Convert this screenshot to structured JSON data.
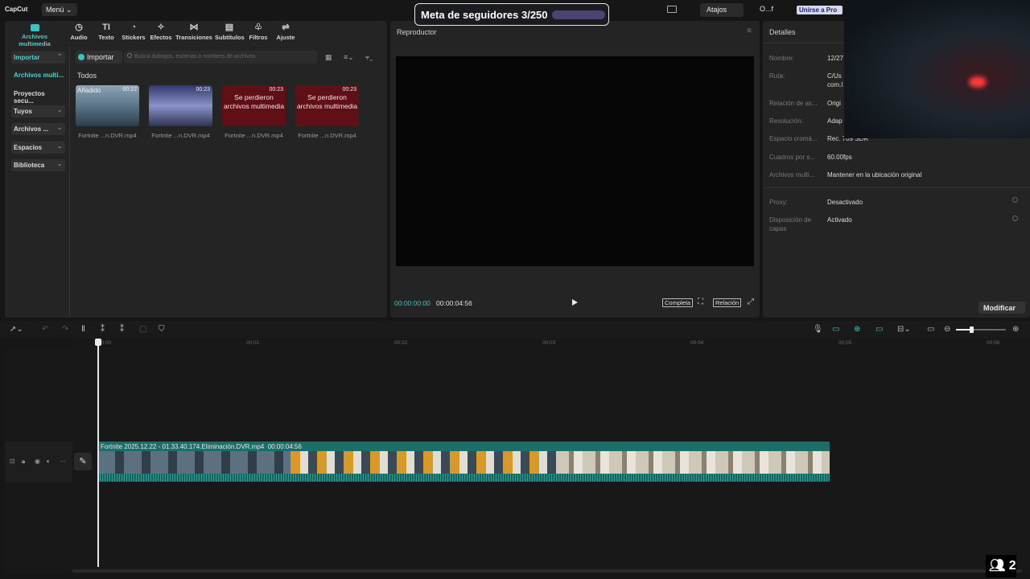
{
  "app": {
    "logo": "CapCut",
    "menu_label": "Menú ⌄"
  },
  "overlay": {
    "goal_text": "Meta de seguidores 3/250",
    "viewers": "2"
  },
  "header": {
    "shortcuts_label": "Atajos",
    "user_label": "O...f",
    "pro_label": "Unirse a Pro"
  },
  "toolbar": {
    "items": [
      {
        "label": "Archivos multimedia",
        "icon": "media-icon"
      },
      {
        "label": "Audio",
        "icon": "audio-icon"
      },
      {
        "label": "Texto",
        "icon": "text-icon"
      },
      {
        "label": "Stickers",
        "icon": "sticker-icon"
      },
      {
        "label": "Efectos",
        "icon": "effects-icon"
      },
      {
        "label": "Transiciones",
        "icon": "transition-icon"
      },
      {
        "label": "Subtítulos",
        "icon": "subtitle-icon"
      },
      {
        "label": "Filtros",
        "icon": "filter-icon"
      },
      {
        "label": "Ajuste",
        "icon": "adjust-icon"
      }
    ]
  },
  "sidebar": {
    "items": [
      {
        "label": "Importar"
      },
      {
        "label": "Archivos multi..."
      },
      {
        "label": "Proyectos secu..."
      },
      {
        "label": "Tuyos"
      },
      {
        "label": "Archivos ..."
      },
      {
        "label": "Espacios"
      },
      {
        "label": "Biblioteca"
      }
    ]
  },
  "media": {
    "import_label": "Importar",
    "search_placeholder": "Busca diálogos, escenas o nombres de archivos",
    "section_label": "Todos",
    "items": [
      {
        "duration": "00:22",
        "badge": "Añadido",
        "name": "Fortnite ...n.DVR.mp4",
        "lost_text": ""
      },
      {
        "duration": "00:23",
        "badge": "",
        "name": "Fortnite ...n.DVR.mp4",
        "lost_text": ""
      },
      {
        "duration": "00:23",
        "badge": "",
        "name": "Fortnite ...n.DVR.mp4",
        "lost_text": "Se perdieron archivos multimedia"
      },
      {
        "duration": "00:23",
        "badge": "",
        "name": "Fortnite ...n.DVR.mp4",
        "lost_text": "Se perdieron archivos multimedia"
      }
    ]
  },
  "player": {
    "title": "Reproductor",
    "current_time": "00:00:00:00",
    "total_time": "00:00:04:56",
    "full_label": "Completa",
    "ratio_label": "Relación"
  },
  "details": {
    "title": "Detalles",
    "rows": [
      {
        "label": "Nombre:",
        "value": "12/27"
      },
      {
        "label": "Ruta:",
        "value": "C/Us com.l"
      },
      {
        "label": "Relación de as...",
        "value": "Origi"
      },
      {
        "label": "Resolución:",
        "value": "Adap"
      },
      {
        "label": "Espacio cromá...",
        "value": "Rec. 709 SDR"
      },
      {
        "label": "Cuadros por s...",
        "value": "60.00fps"
      },
      {
        "label": "Archivos multi...",
        "value": "Mantener en la ubicación original"
      },
      {
        "label": "Proxy:",
        "value": "Desactivado"
      },
      {
        "label": "Disposición de capas",
        "value": "Activado"
      }
    ],
    "modify_label": "Modificar"
  },
  "timeline": {
    "ticks": [
      "00:00",
      "00:01",
      "00:02",
      "00:03",
      "00:04",
      "00:05",
      "00:06"
    ],
    "clip_name": "Fortnite 2025.12.22 - 01.33.40.174.Eliminación.DVR.mp4",
    "clip_duration": "00:00:04:56"
  }
}
